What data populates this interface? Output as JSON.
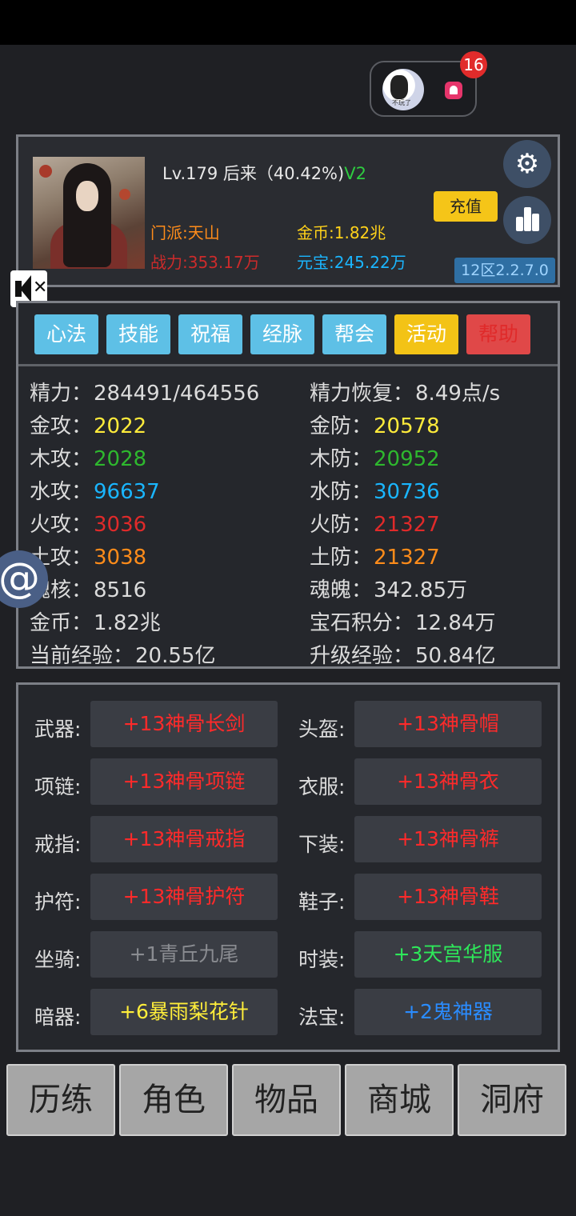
{
  "top": {
    "avatar_caption": "不玩了",
    "notification_count": "16"
  },
  "profile": {
    "level_line": "Lv.179 后来（40.42%)",
    "vip": "V2",
    "sect": "门派:天山",
    "power": "战力:353.17万",
    "gold": "金币:1.82兆",
    "yuanbao": "元宝:245.22万",
    "recharge_label": "充值",
    "version": "12区2.2.7.0"
  },
  "tabs": [
    {
      "label": "心法",
      "color": "#5ec0e6"
    },
    {
      "label": "技能",
      "color": "#5ec0e6"
    },
    {
      "label": "祝福",
      "color": "#5ec0e6"
    },
    {
      "label": "经脉",
      "color": "#5ec0e6"
    },
    {
      "label": "帮会",
      "color": "#5ec0e6"
    },
    {
      "label": "活动",
      "color": "#f3c316"
    },
    {
      "label": "帮助",
      "color": "#e04848"
    }
  ],
  "stats": {
    "stamina": {
      "label": "精力：",
      "value": "284491/464556"
    },
    "stamina_regen": {
      "label": "精力恢复：",
      "value": "8.49点/s"
    },
    "metal_atk": {
      "label": "金攻：",
      "value": "2022"
    },
    "metal_def": {
      "label": "金防：",
      "value": "20578"
    },
    "wood_atk": {
      "label": "木攻：",
      "value": "2028"
    },
    "wood_def": {
      "label": "木防：",
      "value": "20952"
    },
    "water_atk": {
      "label": "水攻：",
      "value": "96637"
    },
    "water_def": {
      "label": "水防：",
      "value": "30736"
    },
    "fire_atk": {
      "label": "火攻：",
      "value": "3036"
    },
    "fire_def": {
      "label": "火防：",
      "value": "21327"
    },
    "earth_atk": {
      "label": "土攻：",
      "value": "3038"
    },
    "earth_def": {
      "label": "土防：",
      "value": "21327"
    },
    "soul_core": {
      "label": "魂核：",
      "value": "8516"
    },
    "soul": {
      "label": "魂魄：",
      "value": "342.85万"
    },
    "gold": {
      "label": "金币：",
      "value": "1.82兆"
    },
    "gem_points": {
      "label": "宝石积分：",
      "value": "12.84万"
    },
    "cur_exp": {
      "label": "当前经验：",
      "value": "20.55亿"
    },
    "next_exp": {
      "label": "升级经验：",
      "value": "50.84亿"
    }
  },
  "equipment": {
    "weapon": {
      "label": "武器:",
      "item": "+13神骨长剑"
    },
    "helmet": {
      "label": "头盔:",
      "item": "+13神骨帽"
    },
    "necklace": {
      "label": "项链:",
      "item": "+13神骨项链"
    },
    "clothes": {
      "label": "衣服:",
      "item": "+13神骨衣"
    },
    "ring": {
      "label": "戒指:",
      "item": "+13神骨戒指"
    },
    "pants": {
      "label": "下装:",
      "item": "+13神骨裤"
    },
    "amulet": {
      "label": "护符:",
      "item": "+13神骨护符"
    },
    "shoes": {
      "label": "鞋子:",
      "item": "+13神骨鞋"
    },
    "mount": {
      "label": "坐骑:",
      "item": "+1青丘九尾"
    },
    "fashion": {
      "label": "时装:",
      "item": "+3天宫华服"
    },
    "hidden_weapon": {
      "label": "暗器:",
      "item": "+6暴雨梨花针"
    },
    "artifact": {
      "label": "法宝:",
      "item": "+2鬼神器"
    }
  },
  "nav": [
    "历练",
    "角色",
    "物品",
    "商城",
    "洞府"
  ]
}
